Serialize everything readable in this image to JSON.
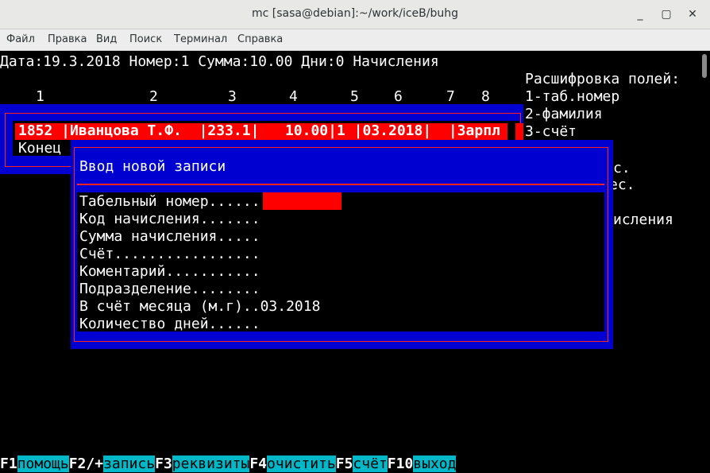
{
  "window": {
    "title": "mc [sasa@debian]:~/work/iceB/buhg",
    "minimize_glyph": "_",
    "maximize_glyph": "▢",
    "close_glyph": "✕"
  },
  "menu": [
    "Файл",
    "Правка",
    "Вид",
    "Поиск",
    "Терминал",
    "Справка"
  ],
  "header_line": "Дата:19.3.2018 Номер:1 Сумма:10.00 Дни:0 Начисления",
  "columns": [
    "1",
    "2",
    "3",
    "4",
    "5",
    "6",
    "7",
    "8"
  ],
  "legend": {
    "title": "Расшифровка полей:",
    "items": [
      "1-таб.номер",
      "2-фамилия",
      "3-счёт"
    ],
    "partial": [
      "с.",
      "ес.",
      "исления"
    ]
  },
  "table": {
    "row": "1852 |Иванцова Т.Ф.  |233.1|   10.00|1 |03.2018|  |Зарпл",
    "end": "Конец"
  },
  "dialog": {
    "title": "Ввод новой записи",
    "fields": [
      "Табельный номер......",
      "Код начисления.......",
      "Сумма начисления.....",
      "Счёт.................",
      "Коментарий...........",
      "Подразделение........",
      "В счёт месяца (м.г)..03.2018",
      "Количество дней......"
    ]
  },
  "fkeys": [
    {
      "key": "F1",
      "label": "помощь"
    },
    {
      "key": "F2/+",
      "label": "запись"
    },
    {
      "key": "F3",
      "label": "реквизиты"
    },
    {
      "key": "F4",
      "label": "очистить"
    },
    {
      "key": "F5",
      "label": "счёт"
    },
    {
      "key": "F10",
      "label": "выход"
    }
  ],
  "colors": {
    "terminal_bg": "#000000",
    "panel_blue": "#0000d0",
    "highlight_red": "#ff0000",
    "fkey_label_bg": "#00b8c8"
  }
}
